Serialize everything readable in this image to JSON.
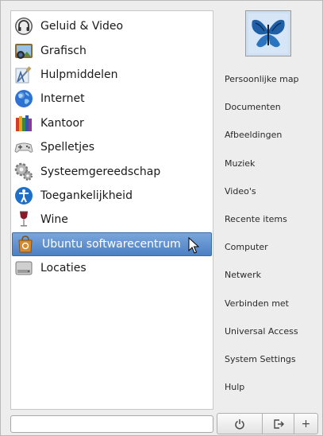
{
  "applications": [
    {
      "label": "Geluid & Video",
      "icon": "headphones-icon"
    },
    {
      "label": "Grafisch",
      "icon": "camera-icon"
    },
    {
      "label": "Hulpmiddelen",
      "icon": "utilities-icon"
    },
    {
      "label": "Internet",
      "icon": "globe-icon"
    },
    {
      "label": "Kantoor",
      "icon": "office-icon"
    },
    {
      "label": "Spelletjes",
      "icon": "gamepad-icon"
    },
    {
      "label": "Systeemgereedschap",
      "icon": "gear-icon"
    },
    {
      "label": "Toegankelijkheid",
      "icon": "accessibility-icon"
    },
    {
      "label": "Wine",
      "icon": "wine-glass-icon"
    },
    {
      "label": "Ubuntu softwarecentrum",
      "icon": "software-center-icon",
      "selected": true
    },
    {
      "label": "Locaties",
      "icon": "drive-icon"
    }
  ],
  "places": [
    "Persoonlijke map",
    "Documenten",
    "Afbeeldingen",
    "Muziek",
    "Video's",
    "Recente items",
    "Computer",
    "Netwerk",
    "Verbinden met",
    "Universal Access",
    "System Settings",
    "Hulp"
  ],
  "search": {
    "value": "",
    "placeholder": ""
  },
  "buttons": {
    "shutdown_icon": "power-icon",
    "logout_icon": "logout-icon",
    "add_label": "+"
  },
  "colors": {
    "selection": "#4c80c4",
    "panel_bg": "#ededed"
  }
}
